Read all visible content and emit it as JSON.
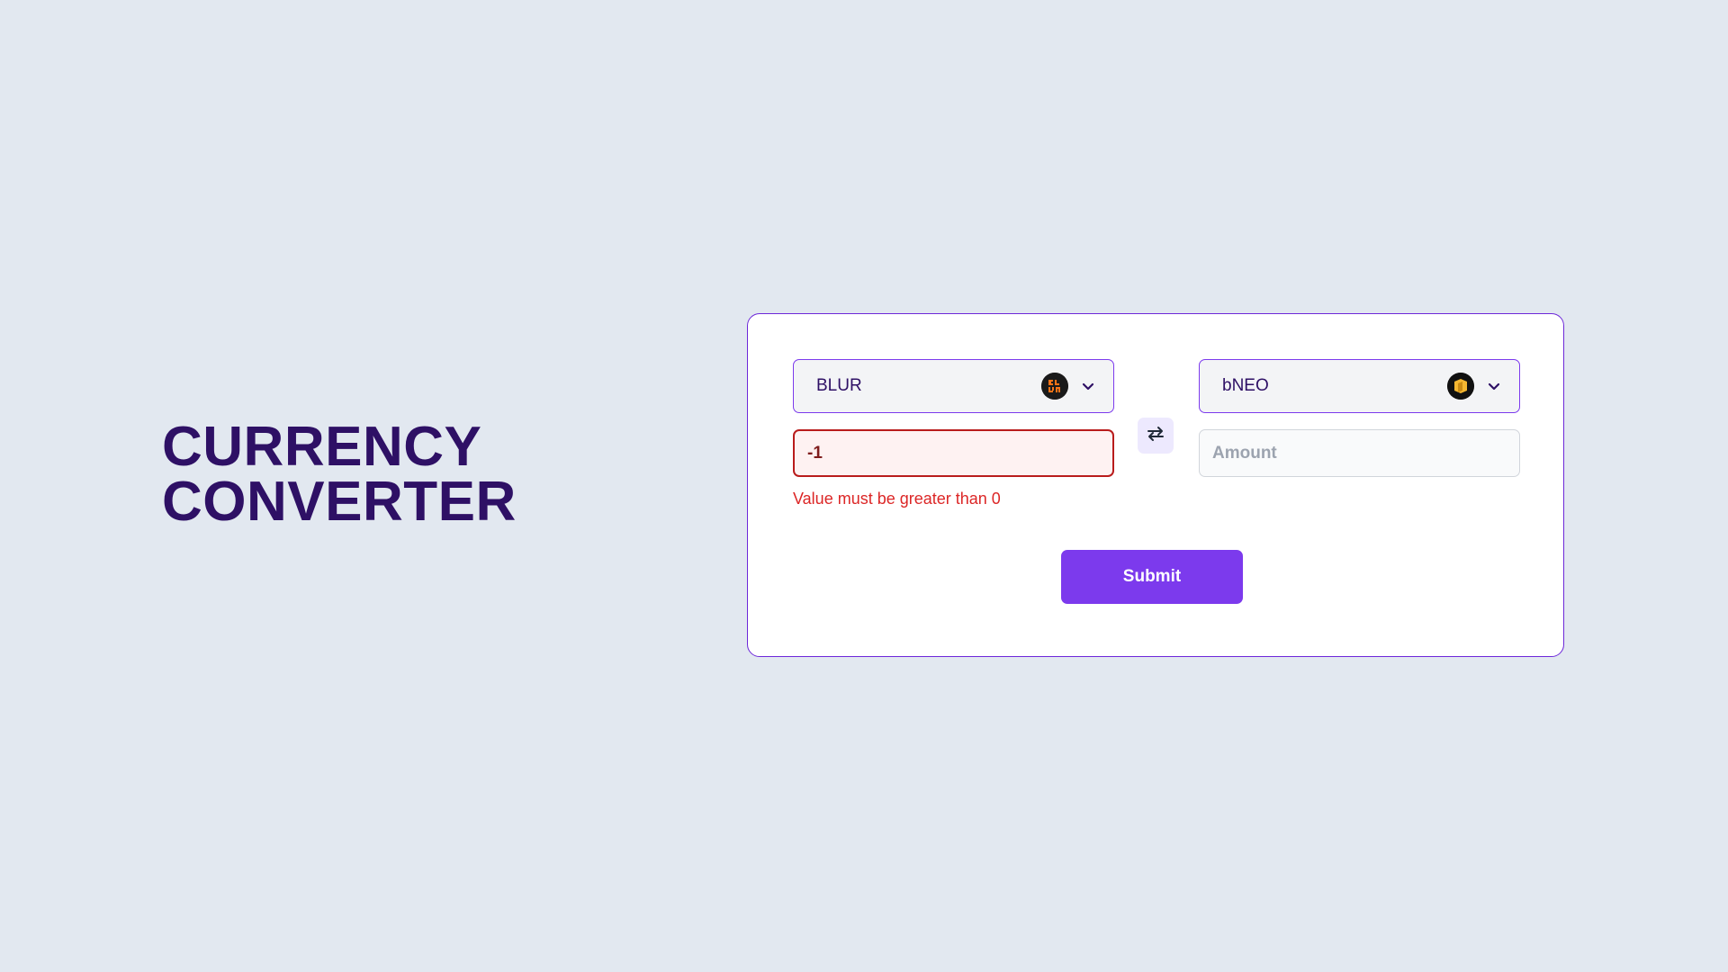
{
  "title": {
    "line1": "CURRENCY",
    "line2": "CONVERTER"
  },
  "converter": {
    "from": {
      "currency": "BLUR",
      "icon": "blur-coin-icon",
      "amount_value": "-1",
      "error": "Value must be greater than 0"
    },
    "to": {
      "currency": "bNEO",
      "icon": "bneo-coin-icon",
      "amount_placeholder": "Amount",
      "amount_value": ""
    },
    "swap_icon": "swap-arrows-icon",
    "submit_label": "Submit"
  },
  "colors": {
    "background": "#e2e8f0",
    "title": "#2e1065",
    "accent": "#7c3aed",
    "error": "#dc2626",
    "blur_coin": "#f97316",
    "bneo_coin": "#f5b731"
  }
}
